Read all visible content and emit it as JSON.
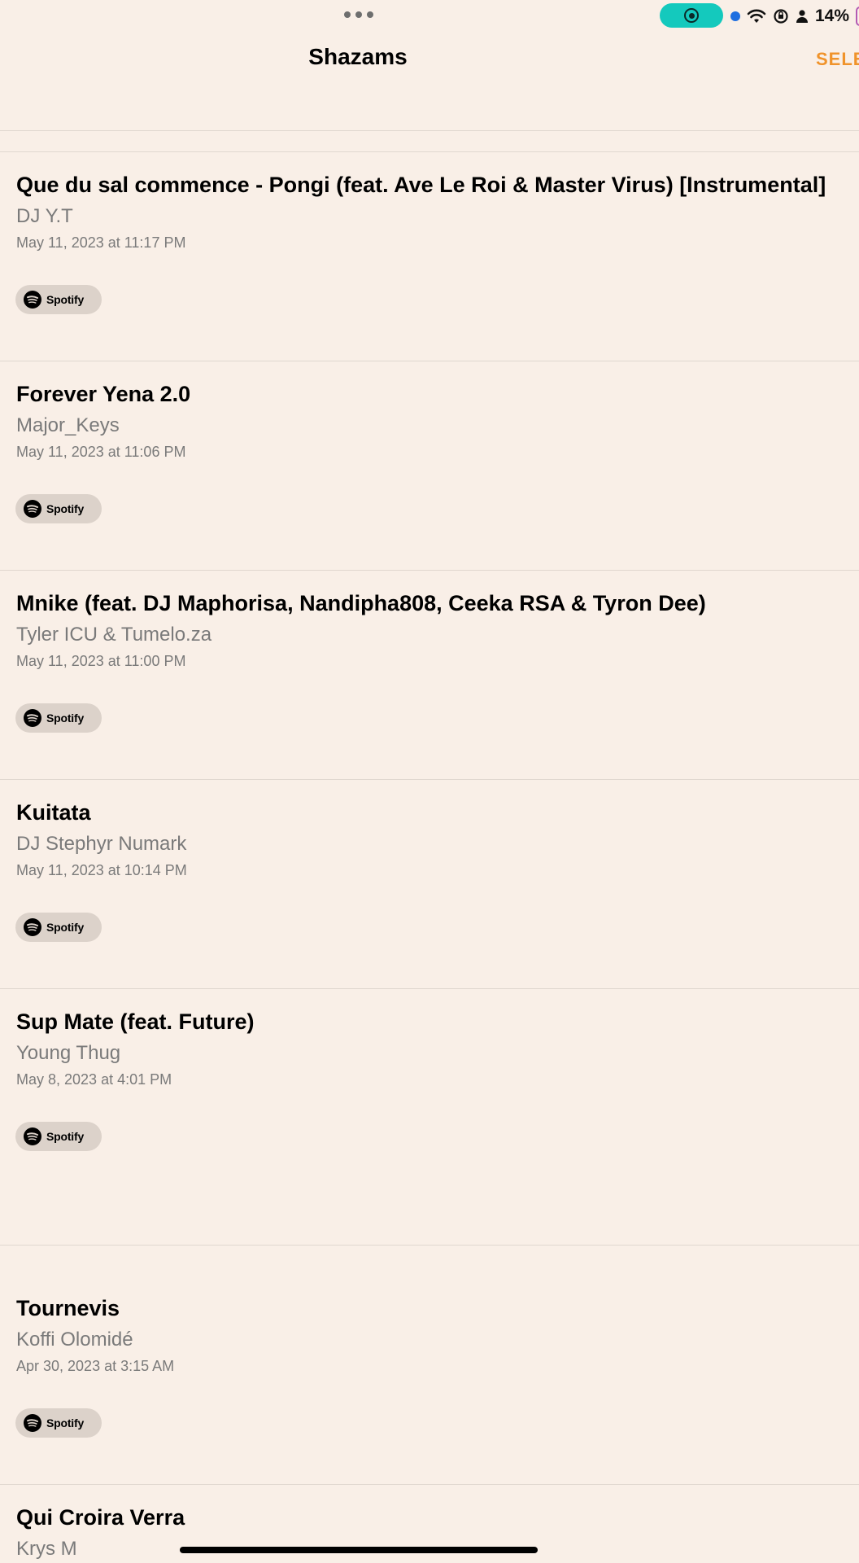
{
  "status_bar": {
    "battery_text": "14%",
    "screen_recording_color": "#14c9bd",
    "icons": [
      "more-dots-icon",
      "screen-record-icon",
      "wifi-icon",
      "orientation-lock-icon",
      "person-icon",
      "battery-icon"
    ]
  },
  "nav": {
    "title": "Shazams",
    "select_label": "SELE",
    "accent_color": "#f0932b"
  },
  "list": {
    "items": [
      {
        "title": "Que du sal commence - Pongi (feat. Ave Le Roi & Master Virus) [Instrumental]",
        "artist": "DJ Y.T",
        "date": "May 11, 2023 at 11:17 PM",
        "service": "Spotify"
      },
      {
        "title": "Forever Yena 2.0",
        "artist": "Major_Keys",
        "date": "May 11, 2023 at 11:06 PM",
        "service": "Spotify"
      },
      {
        "title": "Mnike (feat. DJ Maphorisa, Nandipha808, Ceeka RSA & Tyron Dee)",
        "artist": "Tyler ICU & Tumelo.za",
        "date": "May 11, 2023 at 11:00 PM",
        "service": "Spotify"
      },
      {
        "title": "Kuitata",
        "artist": "DJ Stephyr Numark",
        "date": "May 11, 2023 at 10:14 PM",
        "service": "Spotify"
      },
      {
        "title": "Sup Mate (feat. Future)",
        "artist": "Young Thug",
        "date": "May 8, 2023 at 4:01 PM",
        "service": "Spotify"
      },
      {
        "title": "Tournevis",
        "artist": "Koffi Olomidé",
        "date": "Apr 30, 2023 at 3:15 AM",
        "service": "Spotify"
      },
      {
        "title": "Qui Croira Verra",
        "artist": "Krys M",
        "date": "",
        "service": ""
      }
    ]
  }
}
